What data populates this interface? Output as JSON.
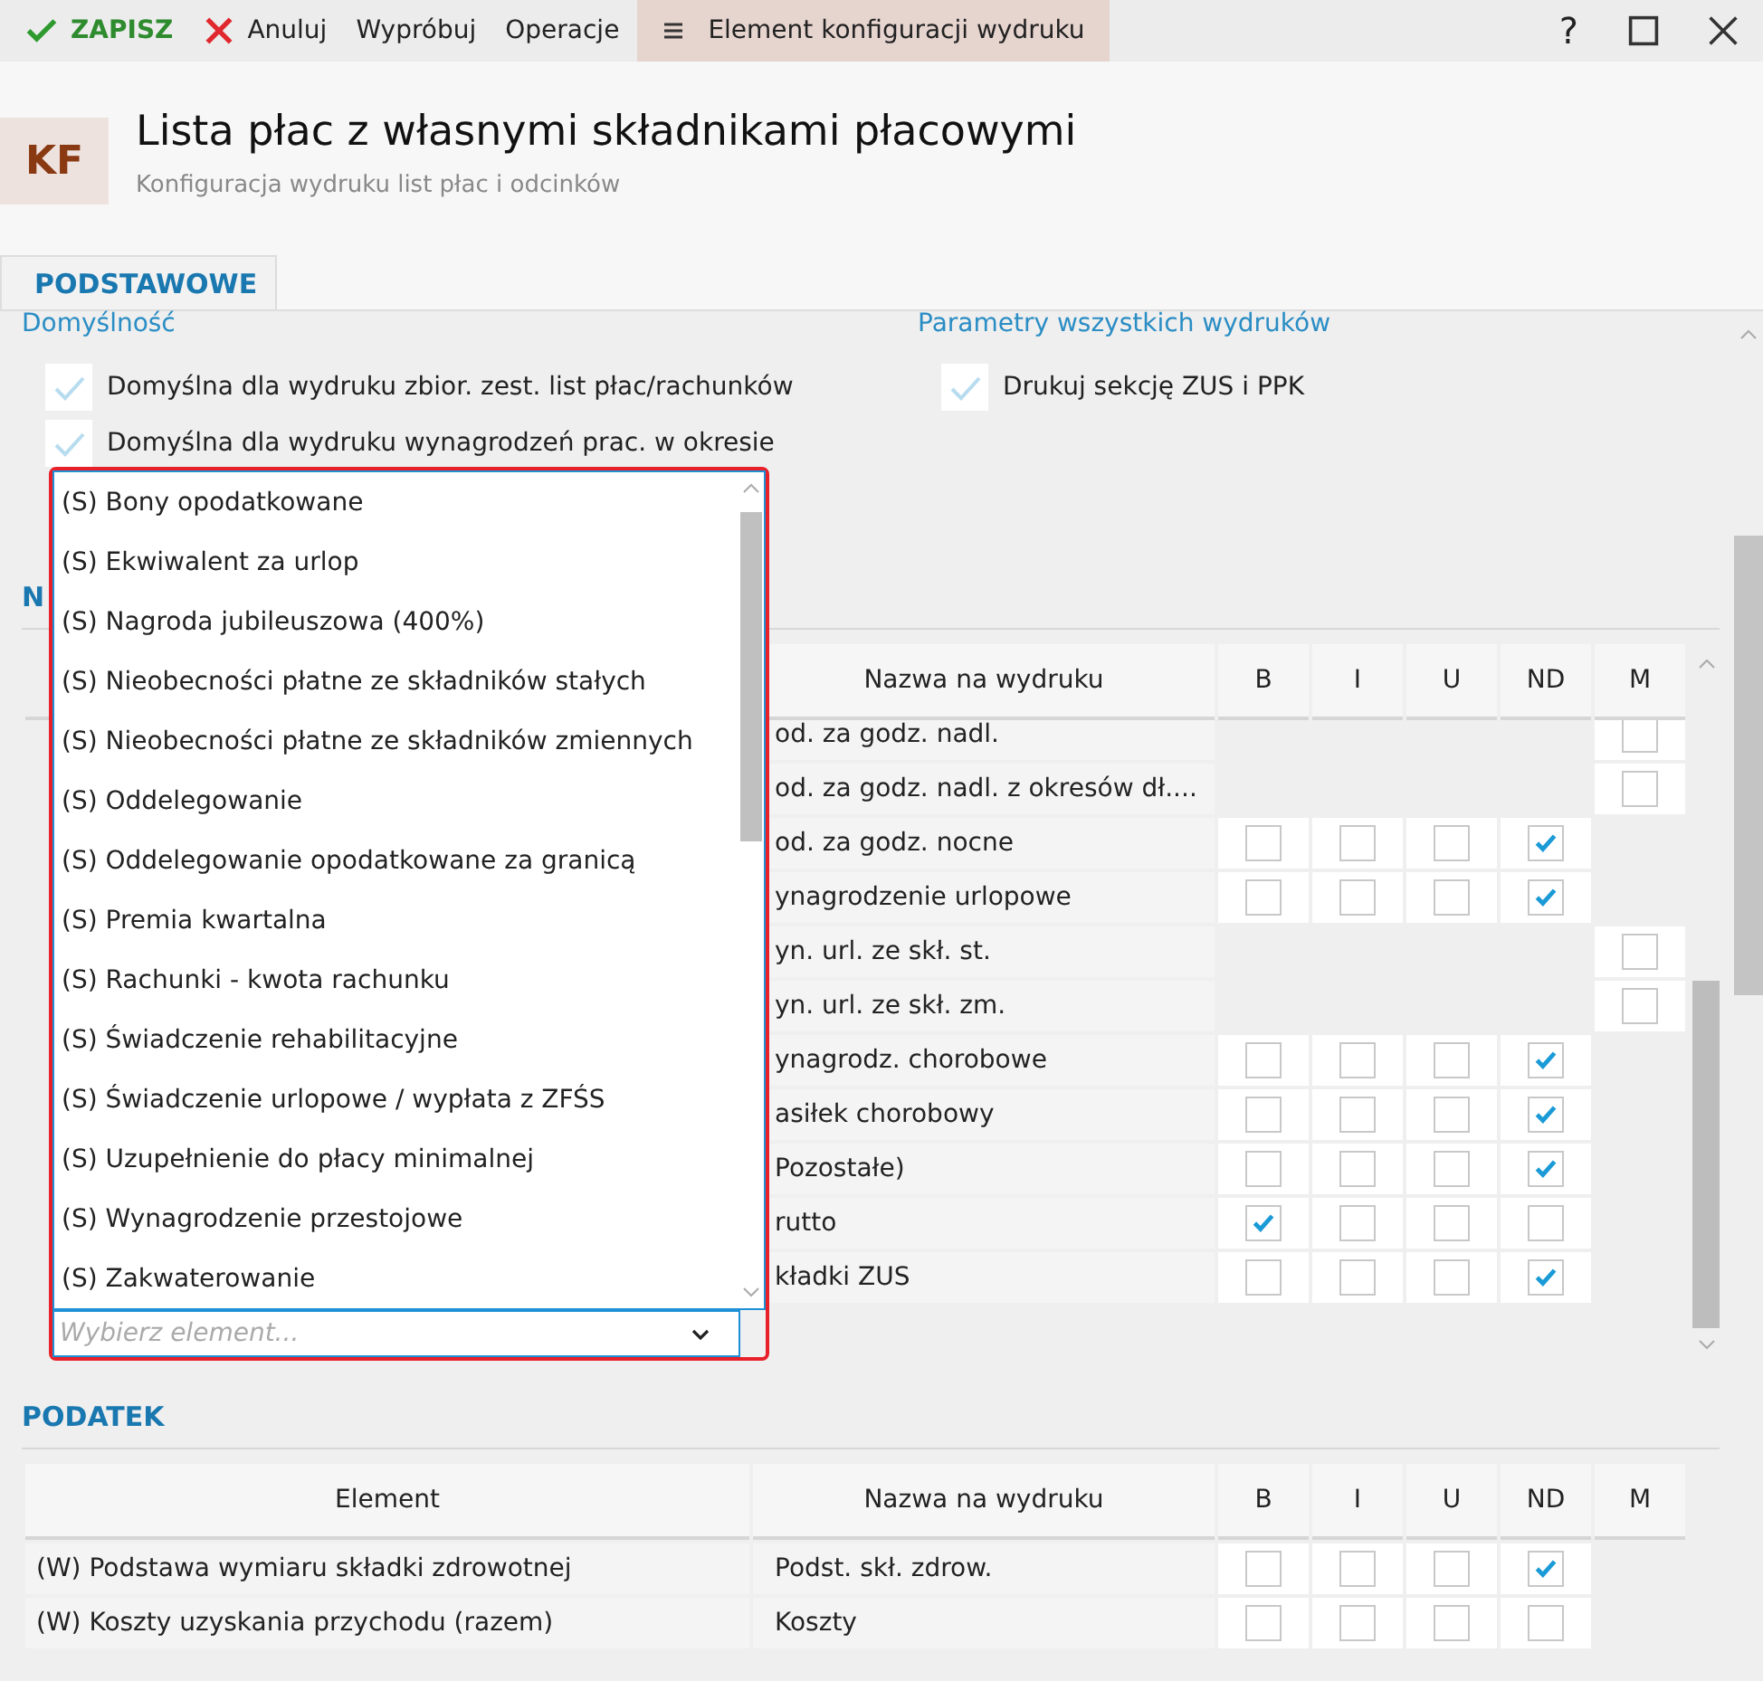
{
  "toolbar": {
    "items": [
      {
        "kind": "save",
        "label": "ZAPISZ"
      },
      {
        "kind": "cancel",
        "label": "Anuluj"
      },
      {
        "kind": "plain",
        "label": "Wypróbuj"
      },
      {
        "kind": "plain",
        "label": "Operacje"
      },
      {
        "kind": "menu",
        "label": "Element konfiguracji wydruku",
        "selected": true
      }
    ],
    "help": "?"
  },
  "header": {
    "badge": "KF",
    "title": "Lista płac z własnymi składnikami płacowymi",
    "subtitle": "Konfiguracja wydruku list płac i odcinków"
  },
  "tabs": [
    {
      "label": "PODSTAWOWE",
      "selected": true
    }
  ],
  "groups": [
    {
      "title": "Domyślność",
      "options": [
        {
          "label": "Domyślna dla wydruku zbior. zest. list płac/rachunków",
          "checked": true
        },
        {
          "label": "Domyślna dla wydruku wynagrodzeń prac. w okresie",
          "checked": true
        }
      ]
    },
    {
      "title": "Parametry wszystkich wydruków",
      "options": [
        {
          "label": "Drukuj sekcję ZUS i PPK",
          "checked": true
        }
      ]
    }
  ],
  "sections": [
    {
      "title": "N",
      "columns": [
        "Nazwa na wydruku",
        "B",
        "I",
        "U",
        "ND",
        "M"
      ],
      "rows": [
        {
          "name": "od. za godz. nadl.",
          "cells": [
            {
              "kind": "empty"
            },
            {
              "kind": "empty"
            },
            {
              "kind": "empty"
            },
            {
              "kind": "empty"
            },
            {
              "kind": "checkbox",
              "checked": false
            }
          ]
        },
        {
          "name": "od. za godz. nadl. z okresów dł....",
          "cells": [
            {
              "kind": "empty"
            },
            {
              "kind": "empty"
            },
            {
              "kind": "empty"
            },
            {
              "kind": "empty"
            },
            {
              "kind": "checkbox",
              "checked": false
            }
          ]
        },
        {
          "name": "od. za godz. nocne",
          "cells": [
            {
              "kind": "checkbox",
              "checked": false
            },
            {
              "kind": "checkbox",
              "checked": false
            },
            {
              "kind": "checkbox",
              "checked": false
            },
            {
              "kind": "checkbox",
              "checked": true
            },
            {
              "kind": "empty"
            }
          ]
        },
        {
          "name": "ynagrodzenie urlopowe",
          "cells": [
            {
              "kind": "checkbox",
              "checked": false
            },
            {
              "kind": "checkbox",
              "checked": false
            },
            {
              "kind": "checkbox",
              "checked": false
            },
            {
              "kind": "checkbox",
              "checked": true
            },
            {
              "kind": "empty"
            }
          ]
        },
        {
          "name": "yn. url. ze skł. st.",
          "cells": [
            {
              "kind": "empty"
            },
            {
              "kind": "empty"
            },
            {
              "kind": "empty"
            },
            {
              "kind": "empty"
            },
            {
              "kind": "checkbox",
              "checked": false
            }
          ]
        },
        {
          "name": "yn. url. ze skł. zm.",
          "cells": [
            {
              "kind": "empty"
            },
            {
              "kind": "empty"
            },
            {
              "kind": "empty"
            },
            {
              "kind": "empty"
            },
            {
              "kind": "checkbox",
              "checked": false
            }
          ]
        },
        {
          "name": "ynagrodz. chorobowe",
          "cells": [
            {
              "kind": "checkbox",
              "checked": false
            },
            {
              "kind": "checkbox",
              "checked": false
            },
            {
              "kind": "checkbox",
              "checked": false
            },
            {
              "kind": "checkbox",
              "checked": true
            },
            {
              "kind": "empty"
            }
          ]
        },
        {
          "name": "asiłek chorobowy",
          "cells": [
            {
              "kind": "checkbox",
              "checked": false
            },
            {
              "kind": "checkbox",
              "checked": false
            },
            {
              "kind": "checkbox",
              "checked": false
            },
            {
              "kind": "checkbox",
              "checked": true
            },
            {
              "kind": "empty"
            }
          ]
        },
        {
          "name": "Pozostałe)",
          "cells": [
            {
              "kind": "checkbox",
              "checked": false
            },
            {
              "kind": "checkbox",
              "checked": false
            },
            {
              "kind": "checkbox",
              "checked": false
            },
            {
              "kind": "checkbox",
              "checked": true
            },
            {
              "kind": "empty"
            }
          ]
        },
        {
          "name": "rutto",
          "cells": [
            {
              "kind": "checkbox",
              "checked": true
            },
            {
              "kind": "checkbox",
              "checked": false
            },
            {
              "kind": "checkbox",
              "checked": false
            },
            {
              "kind": "checkbox",
              "checked": false
            },
            {
              "kind": "empty"
            }
          ]
        },
        {
          "name": "kładki ZUS",
          "cells": [
            {
              "kind": "checkbox",
              "checked": false
            },
            {
              "kind": "checkbox",
              "checked": false
            },
            {
              "kind": "checkbox",
              "checked": false
            },
            {
              "kind": "checkbox",
              "checked": true
            },
            {
              "kind": "empty"
            }
          ]
        }
      ]
    },
    {
      "title": "PODATEK",
      "element_header": "Element",
      "columns": [
        "Nazwa na wydruku",
        "B",
        "I",
        "U",
        "ND",
        "M"
      ],
      "rows": [
        {
          "element": "(W) Podstawa wymiaru składki zdrowotnej",
          "name": "Podst. skł. zdrow.",
          "cells": [
            {
              "kind": "checkbox",
              "checked": false
            },
            {
              "kind": "checkbox",
              "checked": false
            },
            {
              "kind": "checkbox",
              "checked": false
            },
            {
              "kind": "checkbox",
              "checked": true
            },
            {
              "kind": "empty"
            }
          ]
        },
        {
          "element": "(W) Koszty uzyskania przychodu (razem)",
          "name": "Koszty",
          "cells": [
            {
              "kind": "checkbox",
              "checked": false
            },
            {
              "kind": "checkbox",
              "checked": false
            },
            {
              "kind": "checkbox",
              "checked": false
            },
            {
              "kind": "checkbox",
              "checked": false
            },
            {
              "kind": "empty"
            }
          ]
        }
      ]
    }
  ],
  "dropdown": {
    "placeholder": "Wybierz element...",
    "options": [
      "(S) Bony opodatkowane",
      "(S) Ekwiwalent za urlop",
      "(S) Nagroda jubileuszowa (400%)",
      "(S) Nieobecności płatne ze składników stałych",
      "(S) Nieobecności płatne ze składników zmiennych",
      "(S) Oddelegowanie",
      "(S) Oddelegowanie opodatkowane za granicą",
      "(S) Premia kwartalna",
      "(S) Rachunki - kwota rachunku",
      "(S) Świadczenie rehabilitacyjne",
      "(S) Świadczenie urlopowe / wypłata z ZFŚS",
      "(S) Uzupełnienie do płacy minimalnej",
      "(S) Wynagrodzenie przestojowe",
      "(S) Zakwaterowanie"
    ]
  }
}
